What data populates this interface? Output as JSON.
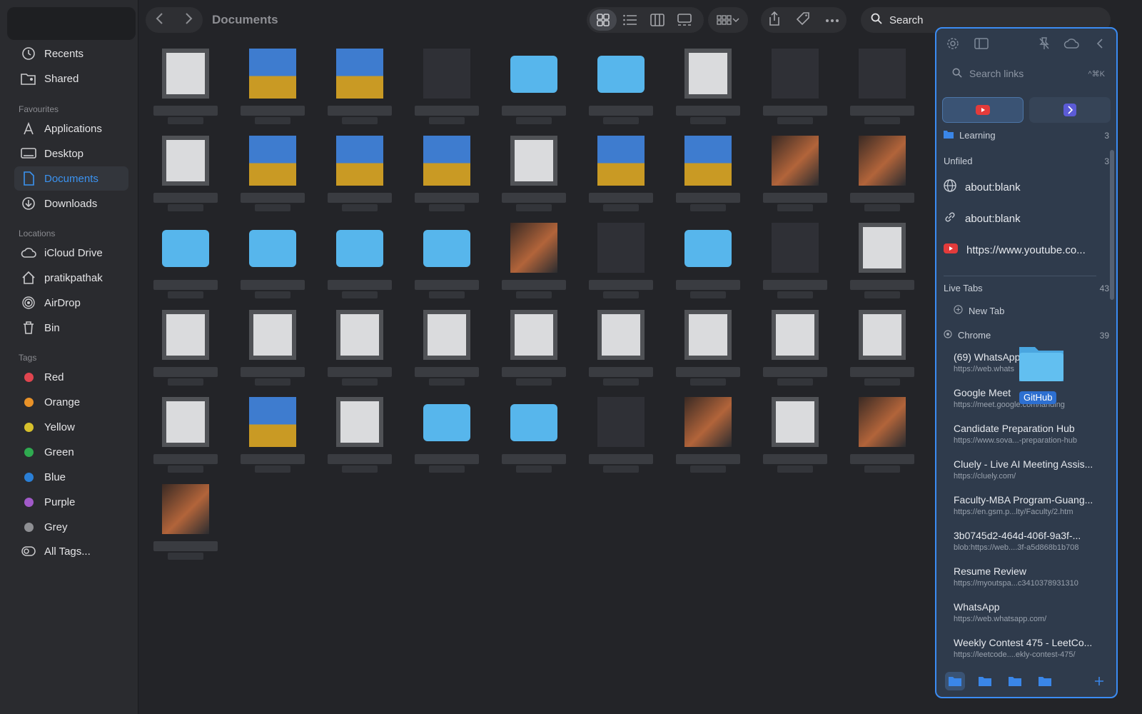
{
  "toolbar": {
    "title": "Documents",
    "search_label": "Search"
  },
  "sidebar": {
    "items_top": [
      {
        "label": "Recents",
        "icon": "clock-icon"
      },
      {
        "label": "Shared",
        "icon": "shared-folder-icon"
      }
    ],
    "favourites_title": "Favourites",
    "favourites": [
      {
        "label": "Applications",
        "icon": "applications-icon"
      },
      {
        "label": "Desktop",
        "icon": "desktop-icon"
      },
      {
        "label": "Documents",
        "icon": "document-icon"
      },
      {
        "label": "Downloads",
        "icon": "download-icon"
      }
    ],
    "locations_title": "Locations",
    "locations": [
      {
        "label": "iCloud Drive",
        "icon": "cloud-icon"
      },
      {
        "label": "pratikpathak",
        "icon": "home-icon"
      },
      {
        "label": "AirDrop",
        "icon": "airdrop-icon"
      },
      {
        "label": "Bin",
        "icon": "trash-icon"
      }
    ],
    "tags_title": "Tags",
    "tags": [
      {
        "label": "Red",
        "color": "#e0454f"
      },
      {
        "label": "Orange",
        "color": "#e99228"
      },
      {
        "label": "Yellow",
        "color": "#d6c02c"
      },
      {
        "label": "Green",
        "color": "#2faa50"
      },
      {
        "label": "Blue",
        "color": "#2a7fd6"
      },
      {
        "label": "Purple",
        "color": "#a15ac9"
      },
      {
        "label": "Grey",
        "color": "#8e8f93"
      }
    ],
    "all_tags_label": "All Tags..."
  },
  "panel": {
    "search_placeholder": "Search links",
    "search_shortcut": "^⌘K",
    "learning_label": "Learning",
    "learning_count": "3",
    "unfiled_label": "Unfiled",
    "unfiled_count": "3",
    "links": [
      {
        "label": "about:blank",
        "icon": "globe-icon"
      },
      {
        "label": "about:blank",
        "icon": "link-icon"
      },
      {
        "label": "https://www.youtube.co...",
        "icon": "youtube-icon"
      }
    ],
    "live_tabs_label": "Live Tabs",
    "live_tabs_count": "43",
    "new_tab_label": "New Tab",
    "chrome_label": "Chrome",
    "chrome_count": "39",
    "chrome_tabs": [
      {
        "title": "(69) WhatsApp",
        "url": "https://web.whats"
      },
      {
        "title": "Google Meet",
        "url": "https://meet.google.com/landing"
      },
      {
        "title": "Candidate Preparation Hub",
        "url": "https://www.sova...-preparation-hub"
      },
      {
        "title": "Cluely - Live AI Meeting Assis...",
        "url": "https://cluely.com/"
      },
      {
        "title": "Faculty-MBA Program-Guang...",
        "url": "https://en.gsm.p...lty/Faculty/2.htm"
      },
      {
        "title": "3b0745d2-464d-406f-9a3f-...",
        "url": "blob:https://web....3f-a5d868b1b708"
      },
      {
        "title": "Resume Review",
        "url": "https://myoutspa...c3410378931310"
      },
      {
        "title": "WhatsApp",
        "url": "https://web.whatsapp.com/"
      },
      {
        "title": "Weekly Contest 475 - LeetCo...",
        "url": "https://leetcode....ekly-contest-475/"
      }
    ],
    "drag_label": "GitHub"
  },
  "grid": {
    "rows": [
      [
        "doc",
        "zip",
        "zip",
        "dark",
        "folder",
        "folder",
        "doc",
        "dark",
        "dark"
      ],
      [
        "doc",
        "zip",
        "zip",
        "zip",
        "doc",
        "zip",
        "zip",
        "photo",
        "photo"
      ],
      [
        "folder",
        "folder",
        "folder",
        "folder",
        "photo",
        "dark",
        "folder",
        "dark",
        "doc"
      ],
      [
        "doc",
        "doc",
        "doc",
        "doc",
        "doc",
        "doc",
        "doc",
        "doc",
        "doc"
      ],
      [
        "doc",
        "zip",
        "doc",
        "folder",
        "folder",
        "dark",
        "photo",
        "doc",
        "photo"
      ],
      [
        "photo"
      ]
    ]
  }
}
